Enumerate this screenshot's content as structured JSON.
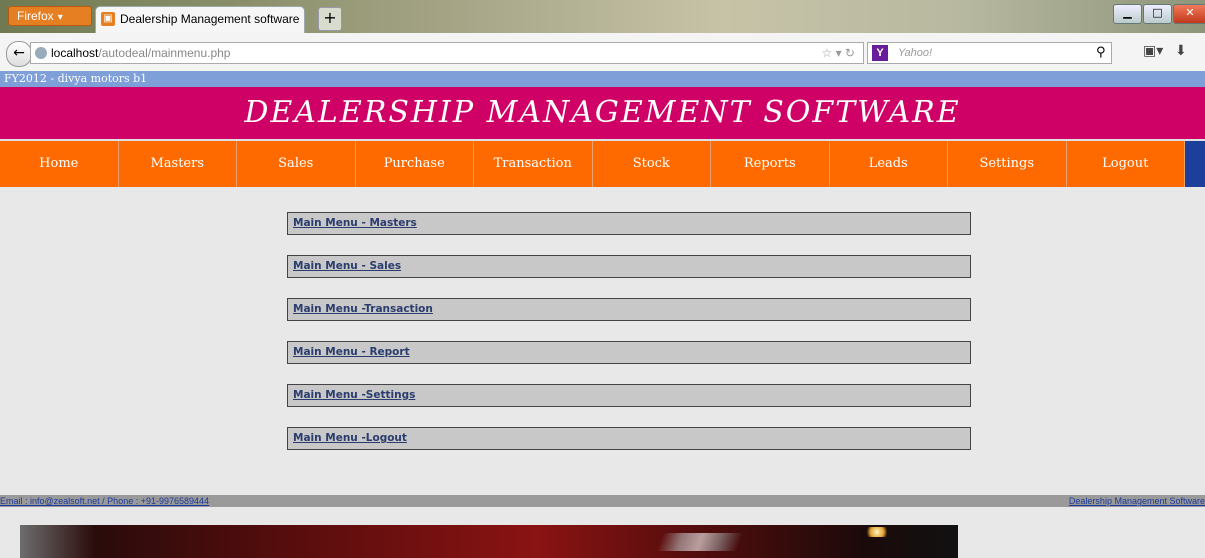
{
  "browser": {
    "app_button": "Firefox",
    "tab_title": "Dealership Management software",
    "new_tab": "+",
    "url_host": "localhost",
    "url_path": "/autodeal/mainmenu.php",
    "search_engine_placeholder": "Yahoo!"
  },
  "page": {
    "fy_label": "FY2012 - divya motors b1",
    "banner_title": "DEALERSHIP MANAGEMENT SOFTWARE",
    "menu": [
      "Home",
      "Masters",
      "Sales",
      "Purchase",
      "Transaction",
      "Stock",
      "Reports",
      "Leads",
      "Settings",
      "Logout"
    ],
    "main_links": [
      "Main Menu - Masters",
      "Main Menu - Sales",
      "Main Menu -Transaction",
      "Main Menu - Report",
      "Main Menu -Settings",
      "Main Menu -Logout"
    ],
    "footer_left": "Email : info@zealsoft.net / Phone : +91-9976589444",
    "footer_right": "Dealership Management Software"
  },
  "colors": {
    "banner": "#cf0066",
    "menu": "#ff6a00",
    "fy_bar": "#7f9fd9"
  }
}
